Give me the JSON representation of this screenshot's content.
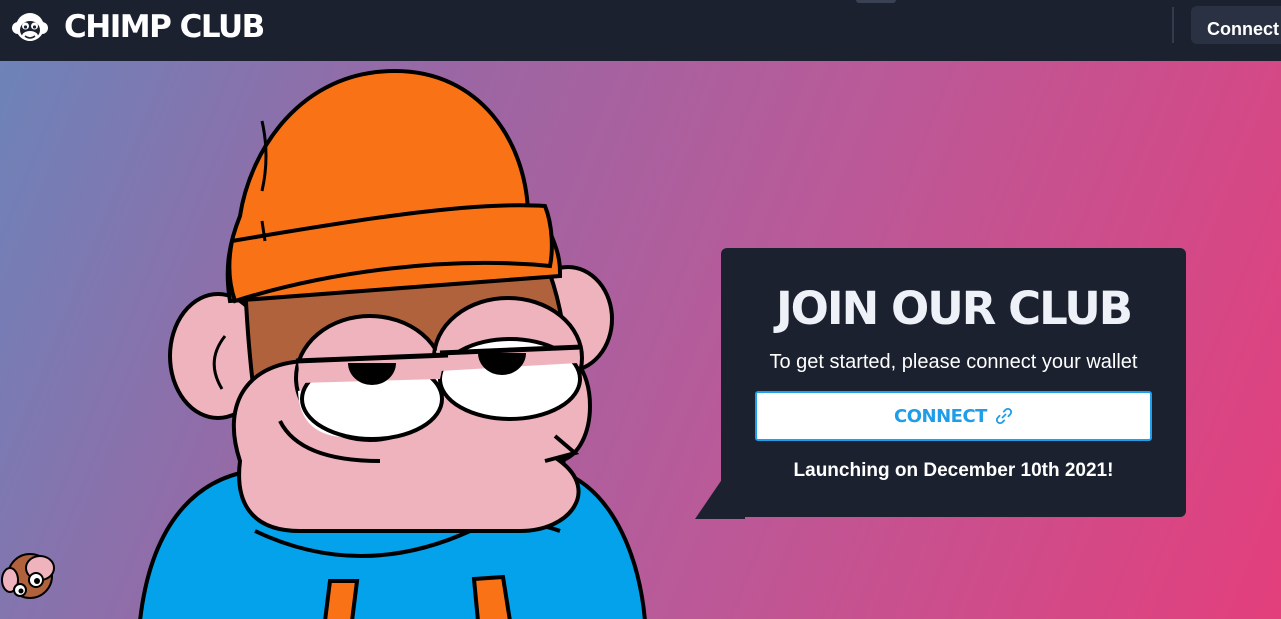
{
  "navbar": {
    "brand": "CHIMP CLUB",
    "connect_label": "Connect",
    "logo_icon": "chimp-logo-icon"
  },
  "hero": {
    "character": "chimp-with-orange-beanie",
    "colors": {
      "gradient_start": "#6d83b9",
      "gradient_end": "#e33f7c",
      "beanie": "#f97316",
      "hoodie": "#03a2ea",
      "skin": "#efb3bd"
    }
  },
  "card": {
    "title": "JOIN OUR CLUB",
    "subtitle": "To get started, please connect your wallet",
    "connect_button_label": "CONNECT",
    "connect_button_icon": "link-icon",
    "launch_text": "Launching on December 10th 2021!",
    "accent_color": "#1ea0ee"
  }
}
